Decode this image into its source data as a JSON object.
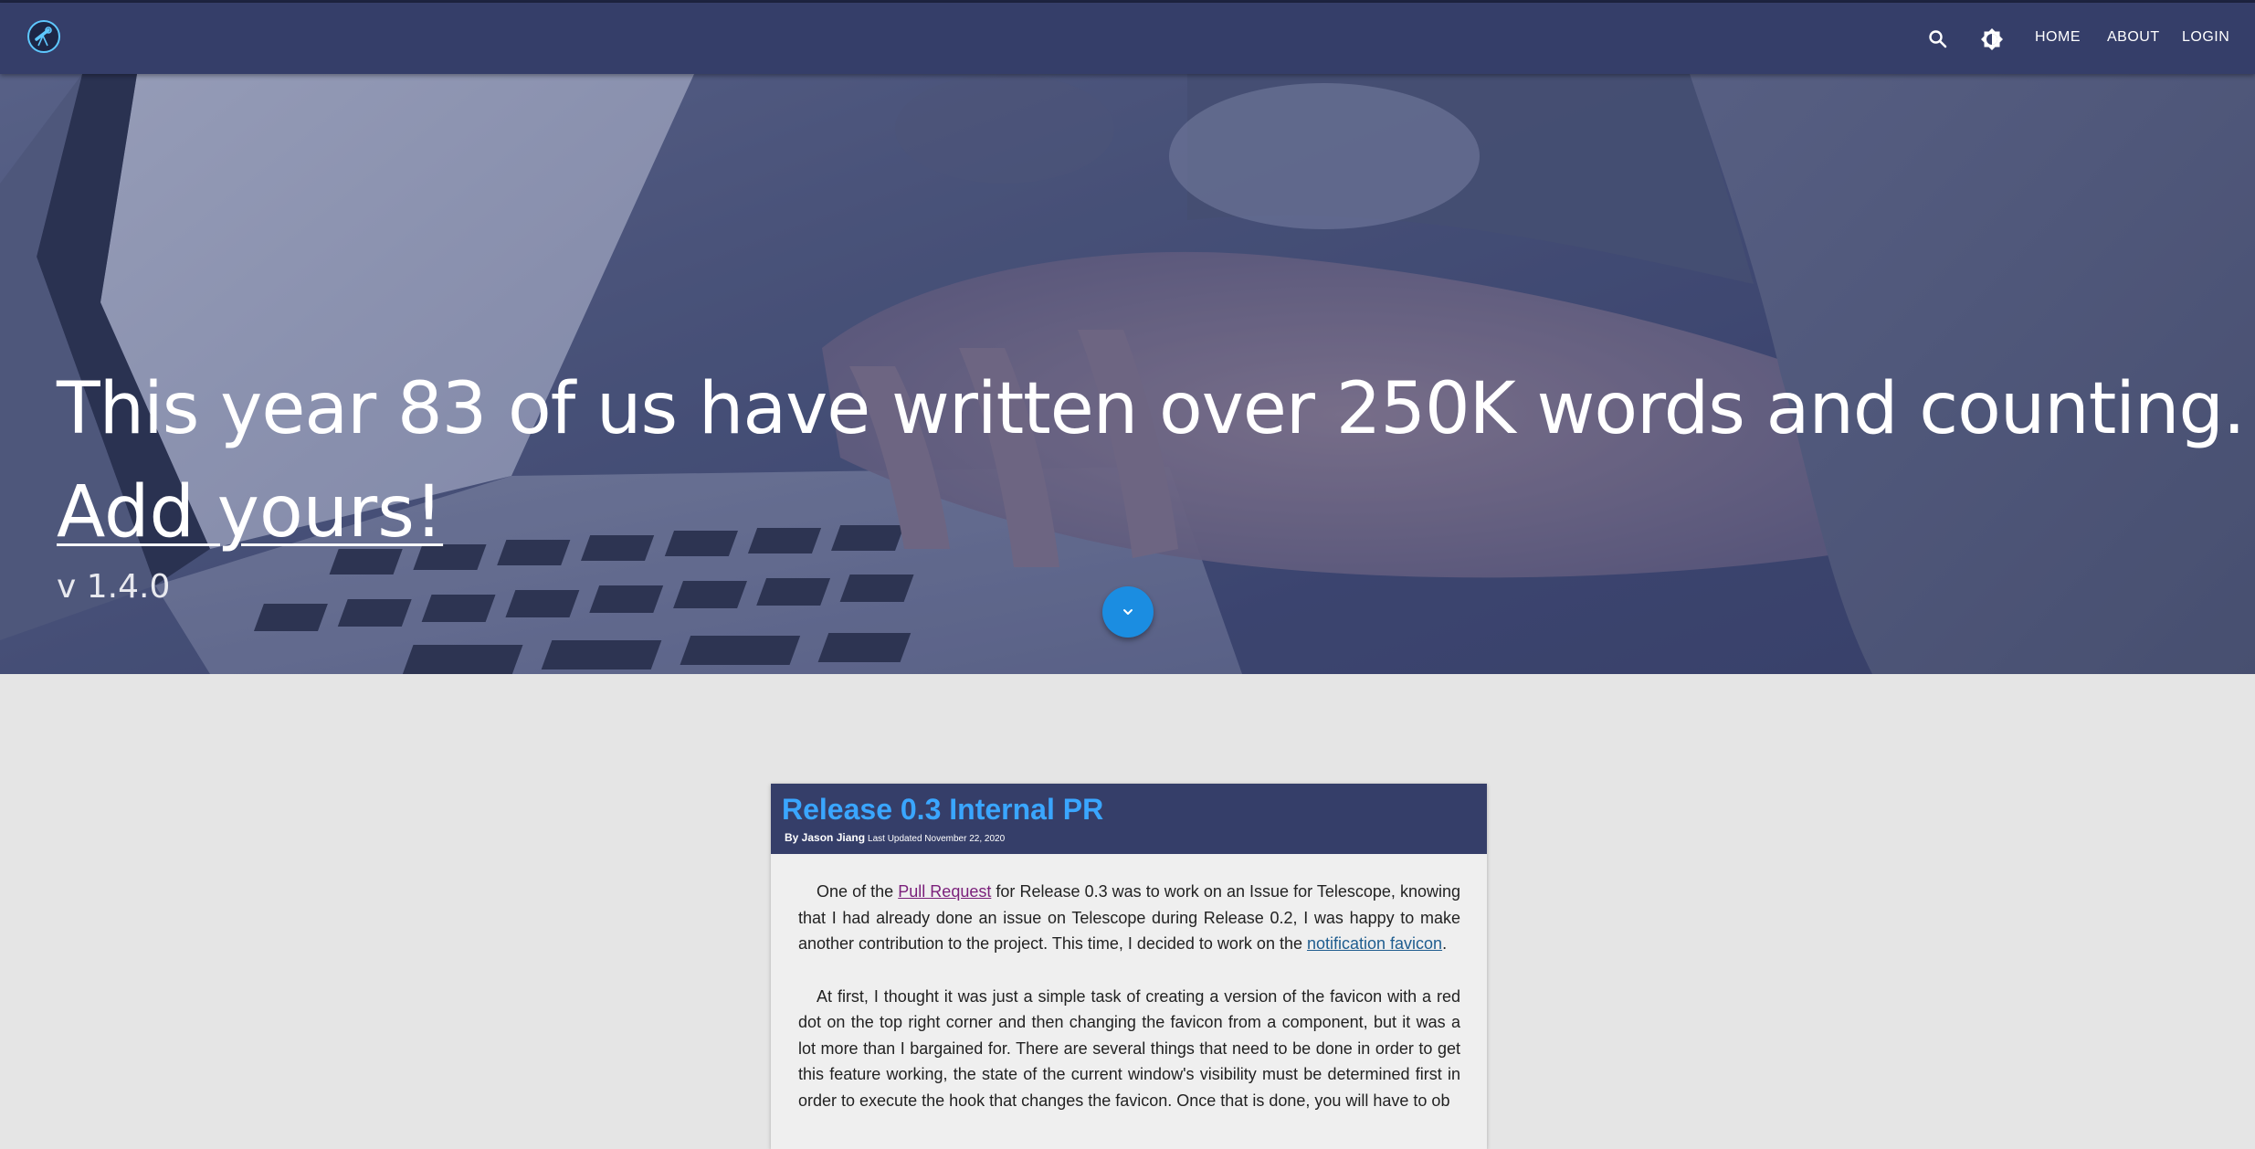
{
  "nav": {
    "logo_icon": "telescope-icon",
    "search_icon": "search-icon",
    "theme_icon": "brightness-icon",
    "links": [
      {
        "label": "HOME"
      },
      {
        "label": "ABOUT"
      },
      {
        "label": "LOGIN"
      }
    ]
  },
  "hero": {
    "title": "This year 83 of us have written over 250K words and counting.",
    "cta": "Add yours!",
    "version": "v 1.4.0",
    "scroll_icon": "chevron-down-icon"
  },
  "post": {
    "title": "Release 0.3 Internal PR",
    "author": "By Jason Jiang",
    "updated": "Last Updated November 22, 2020",
    "p1_before": "One of the ",
    "p1_link1": "Pull Request",
    "p1_middle": " for Release 0.3 was to work on an Issue for Telescope, knowing that I had already done an issue on Telescope during Release 0.2, I was happy to make another contribution to the project. This time, I decided to work on the ",
    "p1_link2": "notification favicon",
    "p1_after": ".",
    "p2": "At first, I thought it was just a simple task of creating a version of the favicon with a red dot on the top right corner and then changing the favicon from a component, but it was a lot more than I bargained for. There are several things that need to be done in order to get this feature working, the state of the current window's visibility must be determined first in order to execute the hook that changes the favicon. Once that is done, you will have to ob"
  },
  "colors": {
    "navbar": "#353e69",
    "accent": "#1b8de1",
    "post_title": "#3aa6ff",
    "page_bg": "#e5e5e5"
  }
}
